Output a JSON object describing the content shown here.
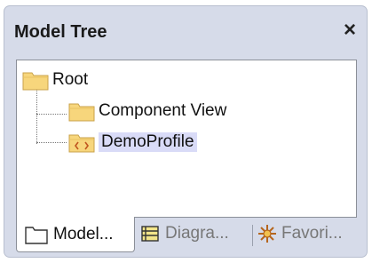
{
  "panel": {
    "title": "Model Tree",
    "close_glyph": "×"
  },
  "tree": {
    "nodes": [
      {
        "label": "Root",
        "icon": "folder-icon"
      },
      {
        "label": "Component View",
        "icon": "folder-icon"
      },
      {
        "label": "DemoProfile",
        "icon": "profile-folder-icon",
        "selected": true
      }
    ]
  },
  "tabs": [
    {
      "label": "Model...",
      "icon": "folder-outline-icon",
      "active": true
    },
    {
      "label": "Diagra...",
      "icon": "diagram-icon",
      "active": false
    },
    {
      "label": "Favori...",
      "icon": "favorites-icon",
      "active": false
    }
  ],
  "colors": {
    "panel_bg": "#d6dbe9",
    "folder_fill": "#f7d67c",
    "selection_bg": "#d9dbf7"
  }
}
